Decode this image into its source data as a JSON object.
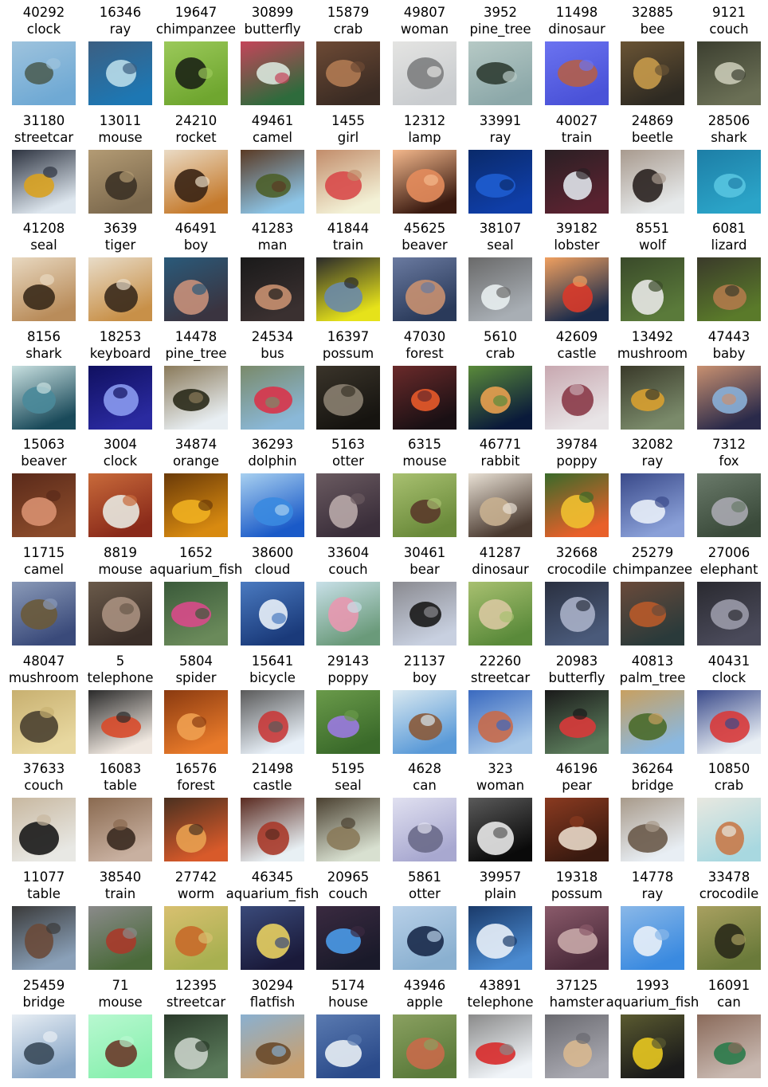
{
  "rows": [
    [
      {
        "id": "40292",
        "label": "clock",
        "colors": [
          "#6fa9d4",
          "#4c5f57",
          "#9ec3dd"
        ]
      },
      {
        "id": "16346",
        "label": "ray",
        "colors": [
          "#1d77b3",
          "#b8dbe9",
          "#3c5f82"
        ]
      },
      {
        "id": "19647",
        "label": "chimpanzee",
        "colors": [
          "#6fa62f",
          "#1c2415",
          "#9bc95a"
        ]
      },
      {
        "id": "30899",
        "label": "butterfly",
        "colors": [
          "#2e6b3c",
          "#d9e6dc",
          "#c4455a"
        ]
      },
      {
        "id": "15879",
        "label": "crab",
        "colors": [
          "#3a2b23",
          "#b07a52",
          "#6d4a35"
        ]
      },
      {
        "id": "49807",
        "label": "woman",
        "colors": [
          "#c9cccf",
          "#7d7e80",
          "#e4e4e2"
        ]
      },
      {
        "id": "3952",
        "label": "pine_tree",
        "colors": [
          "#8ca8a9",
          "#2f3d33",
          "#b6c9c5"
        ]
      },
      {
        "id": "11498",
        "label": "dinosaur",
        "colors": [
          "#4a52d8",
          "#b25e4a",
          "#6b73f0"
        ]
      },
      {
        "id": "32885",
        "label": "bee",
        "colors": [
          "#2e2a22",
          "#c79a4a",
          "#6a5434"
        ]
      },
      {
        "id": "9121",
        "label": "couch",
        "colors": [
          "#6a6f55",
          "#c8c9b5",
          "#3c3f30"
        ]
      }
    ],
    [
      {
        "id": "31180",
        "label": "streetcar",
        "colors": [
          "#dde6ee",
          "#d9a220",
          "#2d3340"
        ]
      },
      {
        "id": "13011",
        "label": "mouse",
        "colors": [
          "#7d6a4e",
          "#3c3226",
          "#b39b74"
        ]
      },
      {
        "id": "24210",
        "label": "rocket",
        "colors": [
          "#c57a2c",
          "#3a2414",
          "#eadbc5"
        ]
      },
      {
        "id": "49461",
        "label": "camel",
        "colors": [
          "#8cc4e6",
          "#4c5f2a",
          "#5a3a24"
        ]
      },
      {
        "id": "1455",
        "label": "girl",
        "colors": [
          "#f3f1d6",
          "#d84a4a",
          "#c28c6a"
        ]
      },
      {
        "id": "12312",
        "label": "lamp",
        "colors": [
          "#3a1a10",
          "#e48c5c",
          "#f4b88c"
        ]
      },
      {
        "id": "33991",
        "label": "ray",
        "colors": [
          "#0f3ea8",
          "#1e5dd0",
          "#0a2a6a"
        ]
      },
      {
        "id": "40027",
        "label": "train",
        "colors": [
          "#5a2230",
          "#dfe3ea",
          "#2a2024"
        ]
      },
      {
        "id": "24869",
        "label": "beetle",
        "colors": [
          "#e6e9ea",
          "#2a2220",
          "#a89a8e"
        ]
      },
      {
        "id": "28506",
        "label": "shark",
        "colors": [
          "#2ba4c8",
          "#56c4e0",
          "#1d7ea6"
        ]
      }
    ],
    [
      {
        "id": "41208",
        "label": "seal",
        "colors": [
          "#b98c5a",
          "#3a2a1a",
          "#e8d8c0"
        ]
      },
      {
        "id": "3639",
        "label": "tiger",
        "colors": [
          "#c89048",
          "#3a2a1c",
          "#e8dcc8"
        ]
      },
      {
        "id": "46491",
        "label": "boy",
        "colors": [
          "#3a3440",
          "#c8907a",
          "#2a5a7a"
        ]
      },
      {
        "id": "41283",
        "label": "man",
        "colors": [
          "#3a3030",
          "#c89070",
          "#1a1a1a"
        ]
      },
      {
        "id": "41844",
        "label": "train",
        "colors": [
          "#e6e21a",
          "#6a8aa8",
          "#2a2a2a"
        ]
      },
      {
        "id": "45625",
        "label": "beaver",
        "colors": [
          "#2a3a5a",
          "#c89070",
          "#6a7aa0"
        ]
      },
      {
        "id": "38107",
        "label": "seal",
        "colors": [
          "#a8aeb4",
          "#e8eef0",
          "#6a6a6a"
        ]
      },
      {
        "id": "39182",
        "label": "lobster",
        "colors": [
          "#1a2a4a",
          "#d83a2a",
          "#f0a060"
        ]
      },
      {
        "id": "8551",
        "label": "wolf",
        "colors": [
          "#5a7a3a",
          "#e8e8e6",
          "#3a4a2a"
        ]
      },
      {
        "id": "6081",
        "label": "lizard",
        "colors": [
          "#5a7a2a",
          "#b07a4a",
          "#3a3a2a"
        ]
      }
    ],
    [
      {
        "id": "8156",
        "label": "shark",
        "colors": [
          "#1a4a5a",
          "#4a8a9a",
          "#c8e0e0"
        ]
      },
      {
        "id": "18253",
        "label": "keyboard",
        "colors": [
          "#2a2aa0",
          "#8a9af0",
          "#101060"
        ]
      },
      {
        "id": "14478",
        "label": "pine_tree",
        "colors": [
          "#e8eef2",
          "#2a2a1a",
          "#8a7a5a"
        ]
      },
      {
        "id": "24534",
        "label": "bus",
        "colors": [
          "#8ab8d8",
          "#d8344a",
          "#7a8a6a"
        ]
      },
      {
        "id": "16397",
        "label": "possum",
        "colors": [
          "#161410",
          "#8a8070",
          "#3a342a"
        ]
      },
      {
        "id": "47030",
        "label": "forest",
        "colors": [
          "#1a1014",
          "#e85a2a",
          "#6a2a2a"
        ]
      },
      {
        "id": "5610",
        "label": "crab",
        "colors": [
          "#0a1a3a",
          "#e8a050",
          "#5a8a3a"
        ]
      },
      {
        "id": "42609",
        "label": "castle",
        "colors": [
          "#e8e4e6",
          "#8a3a48",
          "#c8a8b0"
        ]
      },
      {
        "id": "13492",
        "label": "mushroom",
        "colors": [
          "#7a8a6a",
          "#d8a030",
          "#3a3a2a"
        ]
      },
      {
        "id": "47443",
        "label": "baby",
        "colors": [
          "#2a2a4a",
          "#8ab0d8",
          "#c89070"
        ]
      }
    ],
    [
      {
        "id": "15063",
        "label": "beaver",
        "colors": [
          "#8a4a2a",
          "#d89070",
          "#5a2a1a"
        ]
      },
      {
        "id": "3004",
        "label": "clock",
        "colors": [
          "#8a2a1a",
          "#e8e8e0",
          "#c86a3a"
        ]
      },
      {
        "id": "34874",
        "label": "orange",
        "colors": [
          "#d88a10",
          "#f0b020",
          "#6a3a08"
        ]
      },
      {
        "id": "36293",
        "label": "dolphin",
        "colors": [
          "#1a5ac8",
          "#3a8ae0",
          "#a8d0f0"
        ]
      },
      {
        "id": "5163",
        "label": "otter",
        "colors": [
          "#3a2e3a",
          "#b8a8a8",
          "#6a5a60"
        ]
      },
      {
        "id": "6315",
        "label": "mouse",
        "colors": [
          "#6a8a3a",
          "#5a3a2a",
          "#a8c070"
        ]
      },
      {
        "id": "46771",
        "label": "rabbit",
        "colors": [
          "#4a3a30",
          "#c8b090",
          "#e8e0d4"
        ]
      },
      {
        "id": "39784",
        "label": "poppy",
        "colors": [
          "#e8602a",
          "#f0c030",
          "#3a6a2a"
        ]
      },
      {
        "id": "32082",
        "label": "ray",
        "colors": [
          "#8aa0d8",
          "#e8eef8",
          "#3a4a8a"
        ]
      },
      {
        "id": "7312",
        "label": "fox",
        "colors": [
          "#3a4a3a",
          "#a8a8b0",
          "#6a7a6a"
        ]
      }
    ],
    [
      {
        "id": "11715",
        "label": "camel",
        "colors": [
          "#3a4a7a",
          "#6a5a3a",
          "#8a9ab8"
        ]
      },
      {
        "id": "8819",
        "label": "mouse",
        "colors": [
          "#3a2e28",
          "#a89080",
          "#6a5a4a"
        ]
      },
      {
        "id": "1652",
        "label": "aquarium_fish",
        "colors": [
          "#6a8a5a",
          "#d84a8a",
          "#3a5a3a"
        ]
      },
      {
        "id": "38600",
        "label": "cloud",
        "colors": [
          "#1a3a7a",
          "#e8f0f8",
          "#4a7ac0"
        ]
      },
      {
        "id": "33604",
        "label": "couch",
        "colors": [
          "#6a9a7a",
          "#e898b0",
          "#c8e0e8"
        ]
      },
      {
        "id": "30461",
        "label": "bear",
        "colors": [
          "#c8d0e0",
          "#1a1a1a",
          "#8a8a90"
        ]
      },
      {
        "id": "41287",
        "label": "dinosaur",
        "colors": [
          "#5a8a3a",
          "#d8c8a0",
          "#a8c070"
        ]
      },
      {
        "id": "32668",
        "label": "crocodile",
        "colors": [
          "#4a5a7a",
          "#a8b0c8",
          "#2a3040"
        ]
      },
      {
        "id": "25279",
        "label": "chimpanzee",
        "colors": [
          "#2a3a3a",
          "#b85a2a",
          "#6a4a3a"
        ]
      },
      {
        "id": "27006",
        "label": "elephant",
        "colors": [
          "#4a4a5a",
          "#9a9aa8",
          "#2a2a30"
        ]
      }
    ],
    [
      {
        "id": "48047",
        "label": "mushroom",
        "colors": [
          "#e8d8a0",
          "#4a4030",
          "#c8b070"
        ]
      },
      {
        "id": "5",
        "label": "telephone",
        "colors": [
          "#f0e8e0",
          "#d84a2a",
          "#2a2a2a"
        ]
      },
      {
        "id": "5804",
        "label": "spider",
        "colors": [
          "#e87a2a",
          "#f0a050",
          "#8a3a10"
        ]
      },
      {
        "id": "15641",
        "label": "bicycle",
        "colors": [
          "#e8f0f8",
          "#c83a3a",
          "#5a5a5a"
        ]
      },
      {
        "id": "29143",
        "label": "poppy",
        "colors": [
          "#3a6a2a",
          "#9a7ae0",
          "#6a9a4a"
        ]
      },
      {
        "id": "21137",
        "label": "boy",
        "colors": [
          "#5a9ad8",
          "#8a5a3a",
          "#d8e8f0"
        ]
      },
      {
        "id": "22260",
        "label": "streetcar",
        "colors": [
          "#a8c8e8",
          "#c86a4a",
          "#3a6ac0"
        ]
      },
      {
        "id": "20983",
        "label": "butterfly",
        "colors": [
          "#5a7a5a",
          "#d83a3a",
          "#1a1a1a"
        ]
      },
      {
        "id": "40813",
        "label": "palm_tree",
        "colors": [
          "#8ab8e0",
          "#4a6a2a",
          "#c8a060"
        ]
      },
      {
        "id": "40431",
        "label": "clock",
        "colors": [
          "#e8eef4",
          "#d83a3a",
          "#3a4a8a"
        ]
      }
    ],
    [
      {
        "id": "37633",
        "label": "couch",
        "colors": [
          "#e8e8e4",
          "#1a1a1a",
          "#c8b8a0"
        ]
      },
      {
        "id": "16083",
        "label": "table",
        "colors": [
          "#c8b0a0",
          "#3a2a20",
          "#8a6a50"
        ]
      },
      {
        "id": "16576",
        "label": "forest",
        "colors": [
          "#d85a2a",
          "#e8a050",
          "#4a3020"
        ]
      },
      {
        "id": "21498",
        "label": "castle",
        "colors": [
          "#e8f0f4",
          "#a83a2a",
          "#5a2a20"
        ]
      },
      {
        "id": "5195",
        "label": "seal",
        "colors": [
          "#d8e0d0",
          "#8a7a5a",
          "#4a4030"
        ]
      },
      {
        "id": "4628",
        "label": "can",
        "colors": [
          "#a8a8d0",
          "#6a6a8a",
          "#e0e0f0"
        ]
      },
      {
        "id": "323",
        "label": "woman",
        "colors": [
          "#0a0a0a",
          "#e8e8e8",
          "#5a5a5a"
        ]
      },
      {
        "id": "46196",
        "label": "pear",
        "colors": [
          "#3a1a10",
          "#e8d8c8",
          "#8a3a20"
        ]
      },
      {
        "id": "36264",
        "label": "bridge",
        "colors": [
          "#e8eef4",
          "#6a5a4a",
          "#a89a8a"
        ]
      },
      {
        "id": "10850",
        "label": "crab",
        "colors": [
          "#a8d8e0",
          "#c87a4a",
          "#e8e8e0"
        ]
      }
    ],
    [
      {
        "id": "11077",
        "label": "table",
        "colors": [
          "#8aa0b8",
          "#6a4a3a",
          "#3a3a3a"
        ]
      },
      {
        "id": "38540",
        "label": "train",
        "colors": [
          "#4a6a3a",
          "#a83a2a",
          "#8a8a8a"
        ]
      },
      {
        "id": "27742",
        "label": "worm",
        "colors": [
          "#a8b050",
          "#c86a2a",
          "#d8c070"
        ]
      },
      {
        "id": "46345",
        "label": "aquarium_fish",
        "colors": [
          "#1a1a3a",
          "#e8d060",
          "#3a4a7a"
        ]
      },
      {
        "id": "20965",
        "label": "couch",
        "colors": [
          "#1a1a2a",
          "#4a9ae8",
          "#3a2a40"
        ]
      },
      {
        "id": "5861",
        "label": "otter",
        "colors": [
          "#8ab0d0",
          "#1a2a4a",
          "#b8d0e8"
        ]
      },
      {
        "id": "39957",
        "label": "plain",
        "colors": [
          "#4a8ad0",
          "#e8f0f8",
          "#1a3a6a"
        ]
      },
      {
        "id": "19318",
        "label": "possum",
        "colors": [
          "#4a2a3a",
          "#c8a8a8",
          "#8a5a6a"
        ]
      },
      {
        "id": "14778",
        "label": "ray",
        "colors": [
          "#3a8ae0",
          "#e8f0f8",
          "#8ab8e8"
        ]
      },
      {
        "id": "33478",
        "label": "crocodile",
        "colors": [
          "#6a7a3a",
          "#2a2a1a",
          "#a8a060"
        ]
      }
    ],
    [
      {
        "id": "25459",
        "label": "bridge",
        "colors": [
          "#8aa8c8",
          "#3a4a5a",
          "#e8eef4"
        ]
      },
      {
        "id": "71",
        "label": "mouse",
        "colors": [
          "#8af0b0",
          "#6a3a2a",
          "#b8f8d0"
        ]
      },
      {
        "id": "12395",
        "label": "streetcar",
        "colors": [
          "#5a7a5a",
          "#c8d0c8",
          "#2a3a2a"
        ]
      },
      {
        "id": "30294",
        "label": "flatfish",
        "colors": [
          "#c8a070",
          "#6a4a2a",
          "#8ab0d0"
        ]
      },
      {
        "id": "5174",
        "label": "house",
        "colors": [
          "#2a4a8a",
          "#e8eef4",
          "#5a7ab0"
        ]
      },
      {
        "id": "43946",
        "label": "apple",
        "colors": [
          "#5a7a3a",
          "#c86a4a",
          "#8aa060"
        ]
      },
      {
        "id": "43891",
        "label": "telephone",
        "colors": [
          "#f0f4f8",
          "#d82a2a",
          "#8a8a8a"
        ]
      },
      {
        "id": "37125",
        "label": "hamster",
        "colors": [
          "#a8a8b0",
          "#d8b890",
          "#6a6a70"
        ]
      },
      {
        "id": "1993",
        "label": "aquarium_fish",
        "colors": [
          "#1a1a1a",
          "#e8c820",
          "#5a5a30"
        ]
      },
      {
        "id": "16091",
        "label": "can",
        "colors": [
          "#c8b8b0",
          "#2a7a4a",
          "#8a6a5a"
        ]
      }
    ]
  ]
}
